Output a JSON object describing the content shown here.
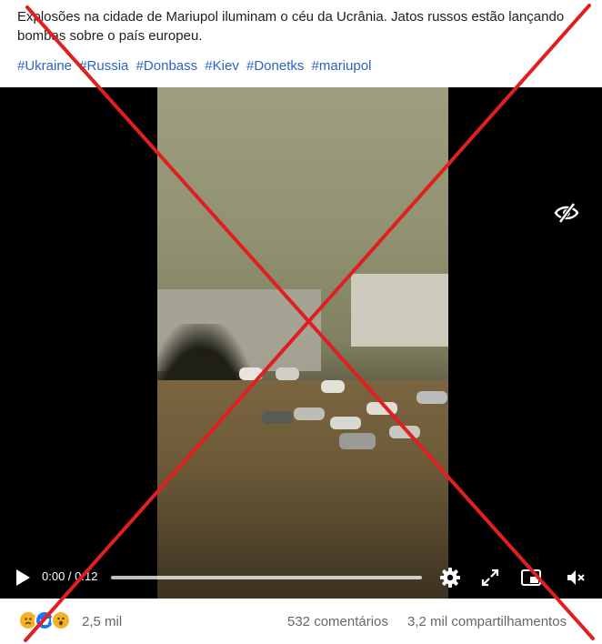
{
  "post": {
    "text": "Explosões na cidade de Mariupol iluminam o céu da Ucrânia. Jatos russos estão lançando bombas sobre o país europeu.",
    "hashtags": [
      "#Ukraine",
      "#Russia",
      "#Donbass",
      "#Kiev",
      "#Donetks",
      "#mariupol"
    ]
  },
  "video": {
    "time_display": "0:00 / 0:12",
    "progress": 0.0,
    "icons": {
      "visibility": "eye-slash-icon",
      "play": "play-icon",
      "settings": "gear-icon",
      "fullscreen": "expand-icon",
      "pip": "picture-in-picture-icon",
      "mute": "speaker-muted-icon"
    }
  },
  "stats": {
    "reactions": [
      "sad-reaction-icon",
      "like-reaction-icon",
      "wow-reaction-icon"
    ],
    "reaction_count": "2,5 mil",
    "comments": "532 comentários",
    "shares": "3,2 mil compartilhamentos"
  },
  "overlay": {
    "mark": "red-x-icon",
    "color": "#e02020"
  },
  "colors": {
    "hashtag": "#2b63c7",
    "video_bg": "#000000",
    "like_blue": "#1877f2",
    "react_yellow": "#f7b125"
  }
}
